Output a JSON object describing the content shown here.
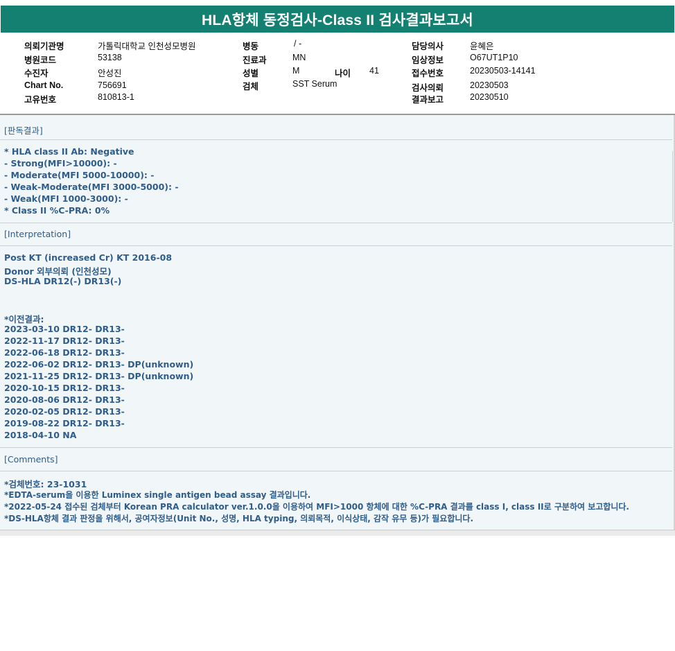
{
  "header": {
    "title": "HLA항체 동정검사-Class II 검사결과보고서"
  },
  "info": {
    "institution_label": "의뢰기관명",
    "institution_value": "가톨릭대학교 인천성모병원",
    "hospital_code_label": "병원코드",
    "hospital_code_value": "53138",
    "recipient_label": "수진자",
    "recipient_value": "안성진",
    "chart_label": "Chart No.",
    "chart_value": "756691",
    "unique_label": "고유번호",
    "unique_value": "810813-1",
    "ward_label": "병동",
    "ward_value": "/ -",
    "dept_label": "진료과",
    "dept_value": "MN",
    "sex_label": "성별",
    "sex_value": "M",
    "age_label": "나이",
    "age_value": "41",
    "specimen_label": "검체",
    "specimen_value": "SST Serum",
    "doctor_label": "담당의사",
    "doctor_value": "윤혜은",
    "clinical_label": "임상정보",
    "clinical_value": "O67UT1P10",
    "receipt_label": "접수번호",
    "receipt_value": "20230503-14141",
    "request_label": "검사의뢰",
    "request_value": "20230503",
    "report_label": "결과보고",
    "report_value": "20230510"
  },
  "results": {
    "section_title": "[판독결과]",
    "lines": [
      "* HLA class II Ab: Negative",
      "- Strong(MFI>10000): -",
      "- Moderate(MFI 5000-10000): -",
      "- Weak-Moderate(MFI 3000-5000): -",
      "- Weak(MFI 1000-3000): -",
      "* Class II %C-PRA: 0%"
    ]
  },
  "interpretation": {
    "section_title": "[Interpretation]",
    "lines": [
      "Post KT (increased Cr) KT 2016-08",
      "Donor 외부의뢰 (인천성모)",
      "DS-HLA DR12(-) DR13(-)"
    ],
    "previous_title": "*이전결과:",
    "previous": [
      "2023-03-10 DR12- DR13-",
      "2022-11-17 DR12- DR13-",
      "2022-06-18 DR12- DR13-",
      "2022-06-02 DR12- DR13- DP(unknown)",
      "2021-11-25 DR12- DR13- DP(unknown)",
      "2020-10-15 DR12- DR13-",
      "2020-08-06 DR12- DR13-",
      "2020-02-05 DR12- DR13-",
      "2019-08-22 DR12- DR13-",
      "2018-04-10 NA"
    ]
  },
  "comments": {
    "section_title": "[Comments]",
    "lines": [
      "*검체번호: 23-1031",
      "*EDTA-serum을 이용한 Luminex single antigen bead assay 결과입니다.",
      "*2022-05-24 접수된 검체부터 Korean PRA calculator ver.1.0.0을 이용하여 MFI>1000 항체에 대한 %C-PRA 결과를 class I, class II로 구분하여 보고합니다.",
      "*DS-HLA항체 결과 판정을 위해서, 공여자정보(Unit No., 성명, HLA typing, 의뢰목적, 이식상태, 감작 유무 등)가 필요합니다."
    ]
  }
}
